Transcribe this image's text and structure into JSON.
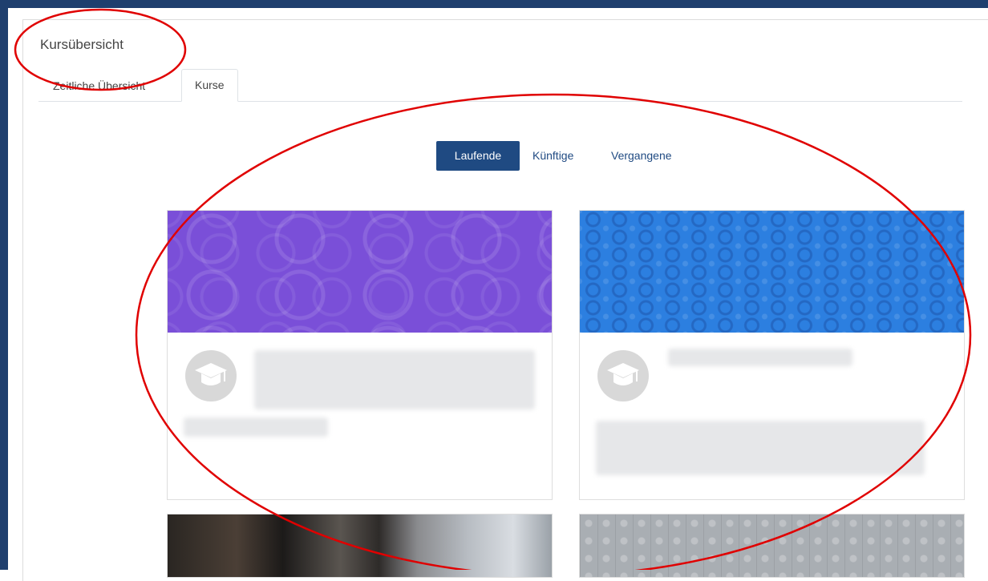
{
  "block": {
    "title": "Kursübersicht"
  },
  "tabs": [
    {
      "label": "Zeitliche Übersicht",
      "active": false
    },
    {
      "label": "Kurse",
      "active": true
    }
  ],
  "filters": [
    {
      "label": "Laufende",
      "active": true
    },
    {
      "label": "Künftige",
      "active": false
    },
    {
      "label": "Vergangene",
      "active": false
    }
  ],
  "courses": [
    {
      "image_color": "#7a4fd8",
      "icon": "graduation-cap-icon",
      "name": "",
      "category": ""
    },
    {
      "image_color": "#2c7fe0",
      "icon": "graduation-cap-icon",
      "name": "",
      "category": ""
    },
    {
      "image_color": "#2a2622",
      "icon": "",
      "name": "",
      "category": ""
    },
    {
      "image_color": "#a9aeb3",
      "icon": "",
      "name": "",
      "category": ""
    }
  ],
  "colors": {
    "frame": "#1f3f6e",
    "accent": "#1f4a82",
    "annotation": "#e00000"
  }
}
